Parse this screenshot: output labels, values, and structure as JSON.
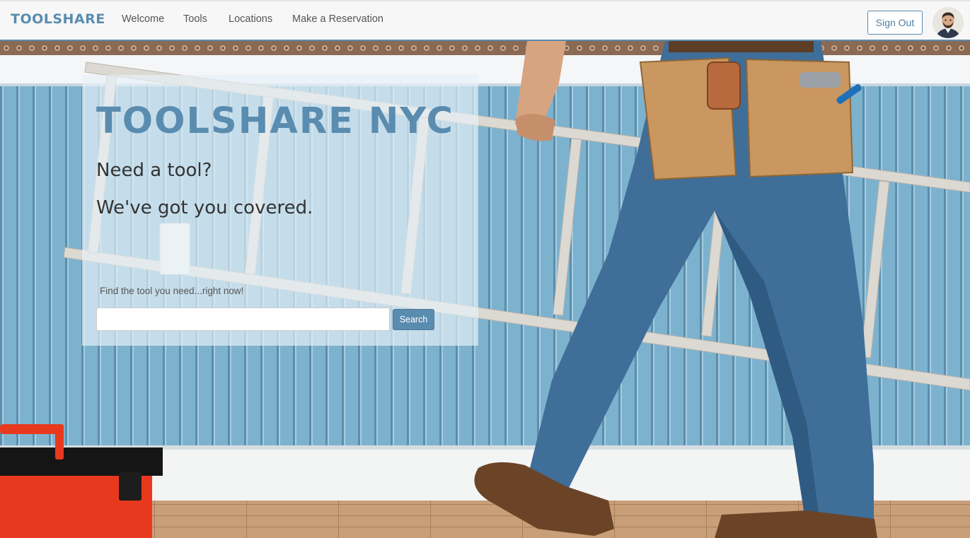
{
  "navbar": {
    "brand": "TOOLSHARE",
    "links": [
      "Welcome",
      "Tools",
      "Locations",
      "Make a Reservation"
    ],
    "sign_out_label": "Sign Out",
    "avatar_icon": "user-avatar-photo"
  },
  "hero": {
    "title": "TOOLSHARE NYC",
    "subtitle_line1": "Need a tool?",
    "subtitle_line2": "We've got you covered.",
    "search_label": "Find the tool you need...right now!",
    "search_value": "",
    "search_placeholder": "",
    "search_button_label": "Search"
  },
  "colors": {
    "accent": "#5a8caf",
    "wall": "#79aecb",
    "floor": "#c7a27c"
  }
}
